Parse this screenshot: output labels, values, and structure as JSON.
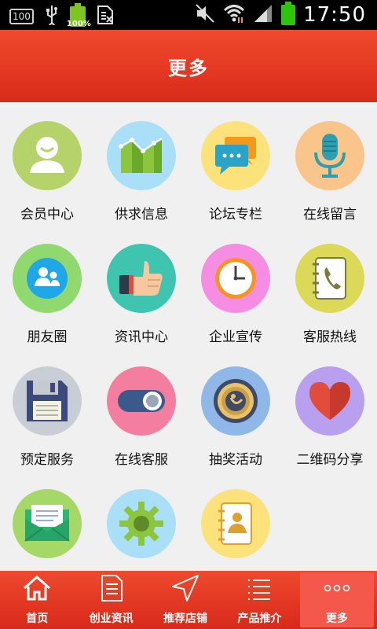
{
  "status_bar": {
    "left_badge": "100",
    "battery_small": "100%",
    "time": "17:50",
    "icons": [
      "usb-icon",
      "sim-icon",
      "mute-icon",
      "wifi-icon",
      "signal-icon",
      "battery-icon"
    ]
  },
  "header": {
    "title": "更多"
  },
  "grid": {
    "items": [
      {
        "label": "会员中心",
        "icon": "member-icon",
        "color": "#b5d36a"
      },
      {
        "label": "供求信息",
        "icon": "chart-icon",
        "color": "#a9dff7"
      },
      {
        "label": "论坛专栏",
        "icon": "chat-bubble-icon",
        "color": "#fce27a"
      },
      {
        "label": "在线留言",
        "icon": "microphone-icon",
        "color": "#f9c58a"
      },
      {
        "label": "朋友圈",
        "icon": "friends-icon",
        "color": "#8fd96e"
      },
      {
        "label": "资讯中心",
        "icon": "thumbs-up-icon",
        "color": "#3fc4b0"
      },
      {
        "label": "企业宣传",
        "icon": "clock-icon",
        "color": "#f58ee3"
      },
      {
        "label": "客服热线",
        "icon": "phone-book-icon",
        "color": "#dcd858"
      },
      {
        "label": "预定服务",
        "icon": "floppy-disk-icon",
        "color": "#c8cdd6"
      },
      {
        "label": "在线客服",
        "icon": "toggle-icon",
        "color": "#f47ea0"
      },
      {
        "label": "抽奖活动",
        "icon": "lottery-icon",
        "color": "#8fb8e8"
      },
      {
        "label": "二维码分享",
        "icon": "heart-icon",
        "color": "#b9a0ee"
      },
      {
        "label": "",
        "icon": "envelope-icon",
        "color": "#a6d868"
      },
      {
        "label": "",
        "icon": "gear-icon",
        "color": "#a9dff7"
      },
      {
        "label": "",
        "icon": "contacts-icon",
        "color": "#fce27a"
      }
    ]
  },
  "bottom_nav": {
    "items": [
      {
        "label": "首页",
        "icon": "home-icon"
      },
      {
        "label": "创业资讯",
        "icon": "document-icon"
      },
      {
        "label": "推荐店铺",
        "icon": "navigation-arrow-icon"
      },
      {
        "label": "产品推介",
        "icon": "list-icon"
      },
      {
        "label": "更多",
        "icon": "more-dots-icon",
        "active": true
      }
    ]
  }
}
